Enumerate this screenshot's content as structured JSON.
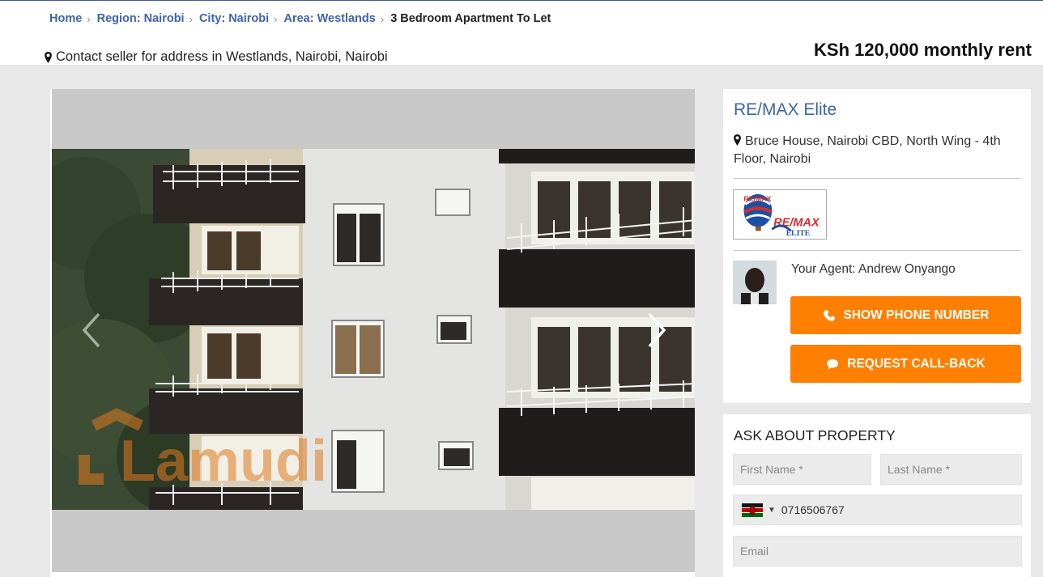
{
  "breadcrumb": {
    "items": [
      {
        "label": "Home"
      },
      {
        "label": "Region: Nairobi"
      },
      {
        "label": "City: Nairobi"
      },
      {
        "label": "Area: Westlands"
      }
    ],
    "current": "3 Bedroom Apartment To Let",
    "separator": "›"
  },
  "listing": {
    "address": "Contact seller for address in Westlands, Nairobi, Nairobi",
    "price": "KSh 120,000 monthly rent"
  },
  "gallery": {
    "watermark": "Lamudi",
    "prev_icon": "chevron-left-icon",
    "next_icon": "chevron-right-icon"
  },
  "agency": {
    "name": "RE/MAX Elite",
    "address": "Bruce House, Nairobi CBD, North Wing - 4th Floor, Nairobi",
    "logo_text_top": "RE/MAX",
    "logo_text_main": "RE/MAX",
    "logo_text_sub": "ELITE"
  },
  "agent": {
    "label": "Your Agent: Andrew Onyango"
  },
  "buttons": {
    "show_phone": "SHOW PHONE NUMBER",
    "callback": "REQUEST CALL-BACK"
  },
  "ask_form": {
    "title": "ASK ABOUT PROPERTY",
    "first_name_placeholder": "First Name *",
    "last_name_placeholder": "Last Name *",
    "phone_value": "0716506767",
    "email_placeholder": "Email",
    "country_flag": "kenya-flag-icon"
  },
  "colors": {
    "accent_orange": "#ff8000",
    "link_blue": "#3f63a8"
  }
}
